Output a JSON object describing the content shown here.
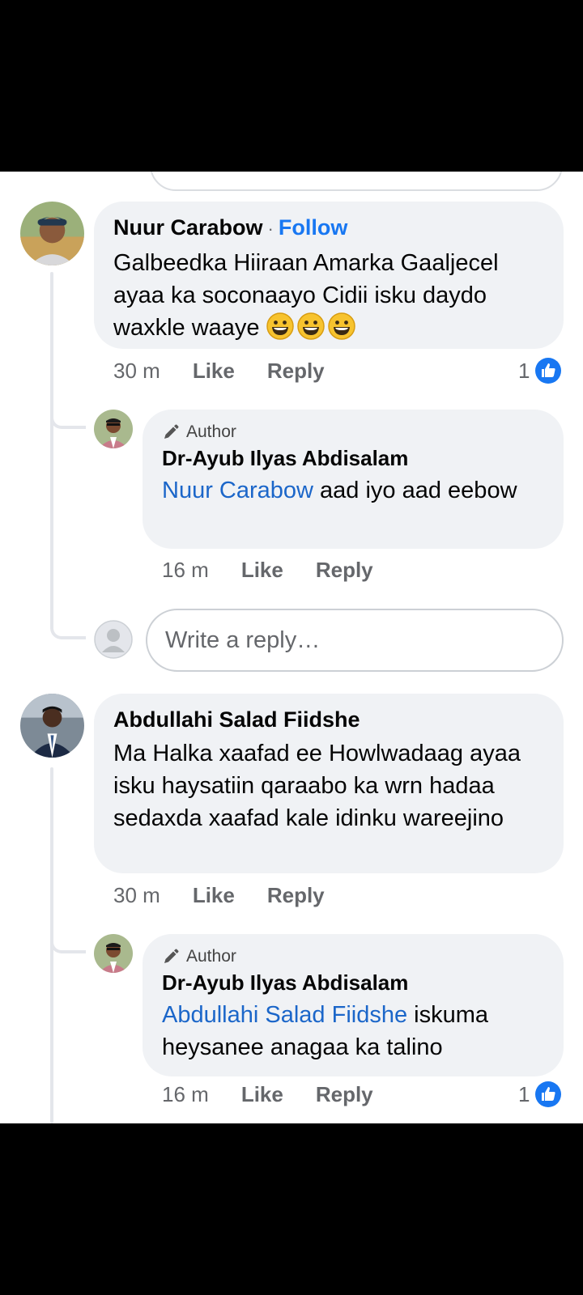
{
  "comments": [
    {
      "author": "Nuur Carabow",
      "follow_label": "Follow",
      "dot": "·",
      "text": "Galbeedka Hiiraan Amarka Gaaljecel ayaa ka soconaayo Cidii isku daydo waxkle waaye",
      "time": "30 m",
      "like_label": "Like",
      "reply_label": "Reply",
      "reaction_count": "1",
      "reply": {
        "author_tag": "Author",
        "author": "Dr-Ayub Ilyas Abdisalam",
        "mention": "Nuur Carabow",
        "text": " aad iyo aad eebow",
        "time": "16 m",
        "like_label": "Like",
        "reply_label": "Reply"
      },
      "write_reply_placeholder": "Write a reply…"
    },
    {
      "author": "Abdullahi Salad Fiidshe",
      "text": "Ma Halka xaafad ee Howlwadaag ayaa isku haysatiin qaraabo ka wrn hadaa sedaxda xaafad kale idinku wareejino",
      "time": "30 m",
      "like_label": "Like",
      "reply_label": "Reply",
      "reply": {
        "author_tag": "Author",
        "author": "Dr-Ayub Ilyas Abdisalam",
        "mention": "Abdullahi Salad Fiidshe",
        "text": " iskuma heysanee anagaa ka talino",
        "time": "16 m",
        "like_label": "Like",
        "reply_label": "Reply",
        "reaction_count": "1"
      }
    }
  ],
  "colors": {
    "bubble": "#f0f2f5",
    "link_blue": "#1877f2",
    "mention_blue": "#1b66c9",
    "meta_gray": "#65676b"
  },
  "icons": [
    "pencil-icon",
    "like-reaction-icon",
    "grinning-emoji-icon",
    "default-avatar-icon"
  ]
}
